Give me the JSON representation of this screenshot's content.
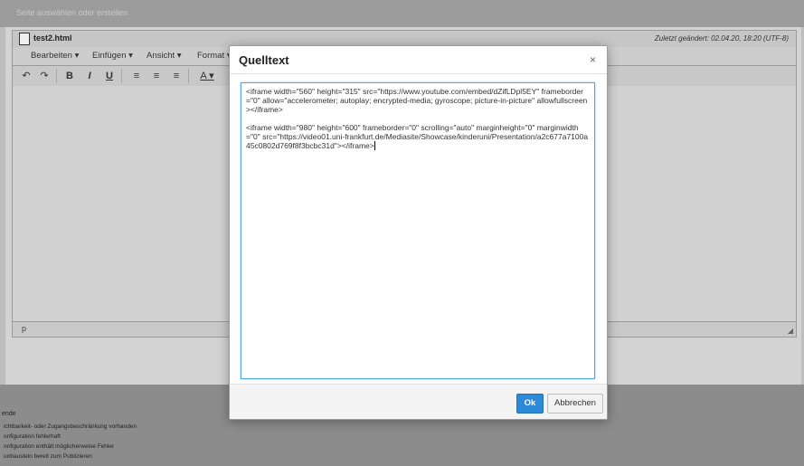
{
  "top_bar": {
    "hint": "Seite auswählen oder erstellen"
  },
  "editor": {
    "file_name": "test2.html",
    "last_changed": "Zuletzt geändert: 02.04.20, 18:20   (UTF-8)",
    "menu": [
      {
        "label": "Bearbeiten ▾"
      },
      {
        "label": "Einfügen ▾"
      },
      {
        "label": "Ansicht ▾"
      },
      {
        "label": "Format ▾"
      }
    ],
    "toolbar": {
      "undo": "↶",
      "redo": "↷",
      "bold": "B",
      "italic": "I",
      "underline": "U",
      "align_left": "≡",
      "align_center": "≡",
      "align_right": "≡",
      "text_color": "A ▾"
    },
    "status_path": "p",
    "resize_glyph": "◢"
  },
  "legend": {
    "title": "ende",
    "items": [
      "ichtbarkeit- oder Zugangsbeschränkung vorhanden",
      "onfiguration fehlerhaft",
      "onfiguration enthält möglicherweise Fehler",
      "unbausteln bereit zum Publizieren"
    ]
  },
  "dialog": {
    "title": "Quelltext",
    "close": "×",
    "source_line1": "<iframe width=\"560\" height=\"315\" src=\"https://www.youtube.com/embed/dZifLDpl5EY\" frameborder=\"0\" allow=\"accelerometer; autoplay; encrypted-media; gyroscope; picture-in-picture\" allowfullscreen></iframe>",
    "source_line2": "<iframe width=\"980\" height=\"600\" frameborder=\"0\" scrolling=\"auto\" marginheight=\"0\" marginwidth=\"0\" src=\"https://video01.uni-frankfurt.de/Mediasite/Showcase/kinderuni/Presentation/a2c677a7100a45c0802d769f8f3bcbc31d\"></iframe>",
    "ok_label": "Ok",
    "cancel_label": "Abbrechen"
  }
}
